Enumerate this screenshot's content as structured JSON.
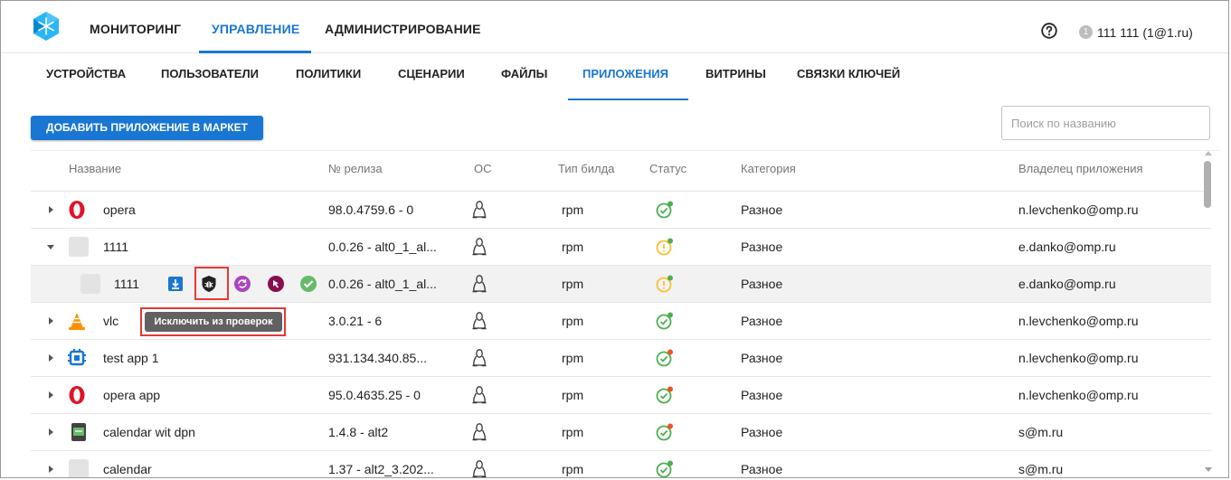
{
  "header": {
    "nav": [
      "МОНИТОРИНГ",
      "УПРАВЛЕНИЕ",
      "АДМИНИСТРИРОВАНИЕ"
    ],
    "active_nav": "УПРАВЛЕНИЕ",
    "user_badge": "1",
    "user_name": "111 111 (1@1.ru)"
  },
  "subnav": {
    "items": [
      "УСТРОЙСТВА",
      "ПОЛЬЗОВАТЕЛИ",
      "ПОЛИТИКИ",
      "СЦЕНАРИИ",
      "ФАЙЛЫ",
      "ПРИЛОЖЕНИЯ",
      "ВИТРИНЫ",
      "СВЯЗКИ КЛЮЧЕЙ"
    ],
    "active": "ПРИЛОЖЕНИЯ"
  },
  "toolbar": {
    "add_label": "ДОБАВИТЬ ПРИЛОЖЕНИЕ В МАРКЕТ",
    "search_placeholder": "Поиск по названию"
  },
  "table": {
    "columns": [
      "Название",
      "№ релиза",
      "ОС",
      "Тип билда",
      "Статус",
      "Категория",
      "Владелец приложения"
    ],
    "rows": [
      {
        "name": "opera",
        "release": "98.0.4759.6 - 0",
        "os": "linux",
        "build": "rpm",
        "status": "ok",
        "status_dot": "#4caf50",
        "category": "Разное",
        "owner": "n.levchenko@omp.ru"
      },
      {
        "name": "1111",
        "release": "0.0.26 - alt0_1_al...",
        "os": "linux",
        "build": "rpm",
        "status": "warning",
        "status_dot": "#4caf50",
        "category": "Разное",
        "owner": "e.danko@omp.ru"
      },
      {
        "name": "1111",
        "release": "0.0.26 - alt0_1_al...",
        "os": "linux",
        "build": "rpm",
        "status": "warning",
        "status_dot": "#4caf50",
        "category": "Разное",
        "owner": "e.danko@omp.ru"
      },
      {
        "name": "vlc",
        "release": "3.0.21 - 6",
        "os": "linux",
        "build": "rpm",
        "status": "ok",
        "status_dot": "#4caf50",
        "category": "Разное",
        "owner": "n.levchenko@omp.ru"
      },
      {
        "name": "test app 1",
        "release": "931.134.340.85...",
        "os": "linux",
        "build": "rpm",
        "status": "ok",
        "status_dot": "#f4511e",
        "category": "Разное",
        "owner": "n.levchenko@omp.ru"
      },
      {
        "name": "opera app",
        "release": "95.0.4635.25 - 0",
        "os": "linux",
        "build": "rpm",
        "status": "ok",
        "status_dot": "#f4511e",
        "category": "Разное",
        "owner": "n.levchenko@omp.ru"
      },
      {
        "name": "calendar wit dpn",
        "release": "1.4.8 - alt2",
        "os": "linux",
        "build": "rpm",
        "status": "ok",
        "status_dot": "#f4511e",
        "category": "Разное",
        "owner": "s@m.ru"
      },
      {
        "name": "calendar",
        "release": "1.37 - alt2_3.202...",
        "os": "linux",
        "build": "rpm",
        "status": "ok",
        "status_dot": "#4caf50",
        "category": "Разное",
        "owner": "s@m.ru"
      }
    ]
  },
  "tooltip": "Исключить из проверок",
  "colors": {
    "accent": "#1976d2",
    "status_ok": "#4caf50",
    "status_warning": "#fbc02d",
    "highlight": "#e53935"
  },
  "icons": {
    "child_actions": [
      "download-icon",
      "shield-bug-icon",
      "sync-icon",
      "cursor-icon",
      "check-circle-icon"
    ]
  }
}
